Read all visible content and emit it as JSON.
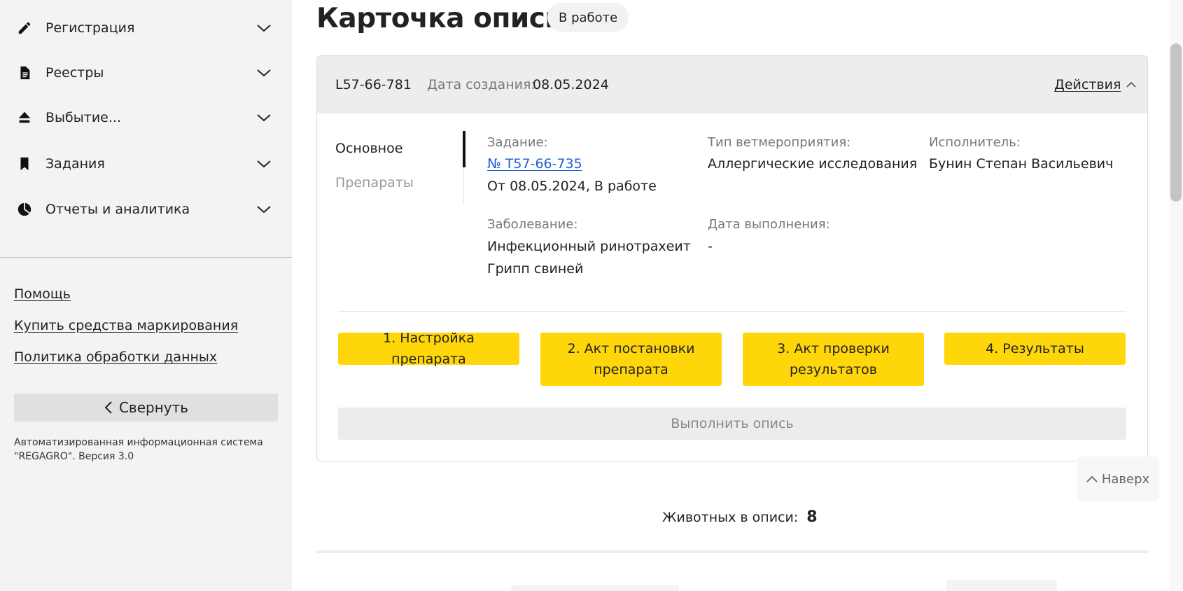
{
  "sidebar": {
    "nav": [
      {
        "label": "Регистрация",
        "icon": "pencil-icon"
      },
      {
        "label": "Реестры",
        "icon": "document-icon"
      },
      {
        "label": "Выбытие...",
        "icon": "upload-icon"
      },
      {
        "label": "Задания",
        "icon": "bookmark-icon"
      },
      {
        "label": "Отчеты и аналитика",
        "icon": "pie-chart-icon"
      }
    ],
    "links": [
      "Помощь",
      "Купить средства маркирования",
      "Политика обработки данных"
    ],
    "collapse_label": "Свернуть",
    "system_info": "Автоматизированная информационная система \"REGAGRO\". Версия 3.0"
  },
  "header": {
    "title": "Карточка описи",
    "status": "В работе"
  },
  "card": {
    "id": "L57-66-781",
    "created_label": "Дата создания:",
    "created_value": "08.05.2024",
    "actions_label": "Действия",
    "tabs": [
      "Основное",
      "Препараты"
    ],
    "fields": {
      "task": {
        "label": "Задание:",
        "link": "№ T57-66-735",
        "extra": "От 08.05.2024, В работе"
      },
      "event_type": {
        "label": "Тип ветмероприятия:",
        "value": "Аллергические исследования"
      },
      "executor": {
        "label": "Исполнитель:",
        "value": "Бунин Степан Васильевич"
      },
      "disease": {
        "label": "Заболевание:",
        "values": [
          "Инфекционный ринотрахеит",
          "Грипп свиней"
        ]
      },
      "completion_date": {
        "label": "Дата выполнения:",
        "value": "-"
      }
    },
    "steps": [
      {
        "line1": "1. Настройка препарата",
        "line2": ""
      },
      {
        "line1": "2. Акт постановки",
        "line2": "препарата"
      },
      {
        "line1": "3. Акт проверки",
        "line2": "результатов"
      },
      {
        "line1": "4. Результаты",
        "line2": ""
      }
    ],
    "execute_label": "Выполнить опись"
  },
  "back_to_top_label": "Наверх",
  "animals": {
    "label": "Животных в описи:",
    "count": "8"
  },
  "colors": {
    "accent": "#ffd60a",
    "link": "#2060d6",
    "sidebar_bg": "#f3f3f3"
  }
}
